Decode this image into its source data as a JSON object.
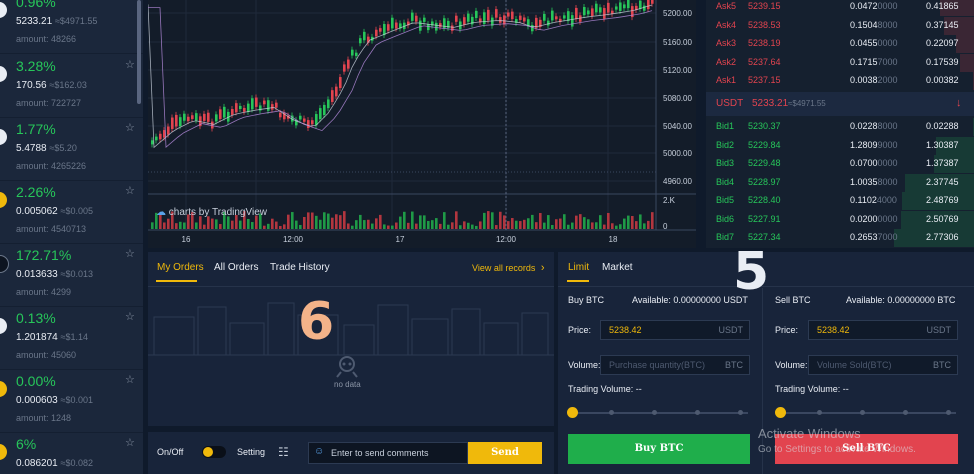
{
  "markets": [
    {
      "change": "0.96%",
      "price": "5233.21",
      "approx": "≈$4971.55",
      "amount": "amount: 48266"
    },
    {
      "change": "3.28%",
      "price": "170.56",
      "approx": "≈$162.03",
      "amount": "amount: 722727"
    },
    {
      "change": "1.77%",
      "price": "5.4788",
      "approx": "≈$5.20",
      "amount": "amount: 4265226"
    },
    {
      "change": "2.26%",
      "price": "0.005062",
      "approx": "≈$0.005",
      "amount": "amount: 4540713"
    },
    {
      "change": "172.71%",
      "price": "0.013633",
      "approx": "≈$0.013",
      "amount": "amount: 4299"
    },
    {
      "change": "0.13%",
      "price": "1.201874",
      "approx": "≈$1.14",
      "amount": "amount: 45060"
    },
    {
      "change": "0.00%",
      "price": "0.000603",
      "approx": "≈$0.001",
      "amount": "amount: 1248"
    },
    {
      "change": "6%",
      "price": "0.086201",
      "approx": "≈$0.082",
      "amount": ""
    }
  ],
  "chart": {
    "price_ticks": [
      "5200.00",
      "5160.00",
      "5120.00",
      "5080.00",
      "5040.00",
      "5000.00",
      "4960.00"
    ],
    "volume_ticks": [
      "2.K",
      "0"
    ],
    "time_ticks": [
      "16",
      "12:00",
      "17",
      "12:00",
      "18"
    ],
    "watermark": "charts by TradingView"
  },
  "orderbook": {
    "asks": [
      {
        "name": "Ask5",
        "price": "5239.15",
        "qty": "0.0472",
        "qty_tail": "0000",
        "total": "0.41865",
        "depth": 0.42
      },
      {
        "name": "Ask4",
        "price": "5238.53",
        "qty": "0.1504",
        "qty_tail": "8000",
        "total": "0.37145",
        "depth": 0.37
      },
      {
        "name": "Ask3",
        "price": "5238.19",
        "qty": "0.0455",
        "qty_tail": "0000",
        "total": "0.22097",
        "depth": 0.22
      },
      {
        "name": "Ask2",
        "price": "5237.64",
        "qty": "0.1715",
        "qty_tail": "7000",
        "total": "0.17539",
        "depth": 0.18
      },
      {
        "name": "Ask1",
        "price": "5237.15",
        "qty": "0.0038",
        "qty_tail": "2000",
        "total": "0.00382",
        "depth": 0.01
      }
    ],
    "last": {
      "symbol": "USDT",
      "price": "5233.21",
      "approx": "≈$4971.55",
      "arrow": "↓"
    },
    "bids": [
      {
        "name": "Bid1",
        "price": "5230.37",
        "qty": "0.0228",
        "qty_tail": "8000",
        "total": "0.02288",
        "depth": 0.01
      },
      {
        "name": "Bid2",
        "price": "5229.84",
        "qty": "1.2809",
        "qty_tail": "9000",
        "total": "1.30387",
        "depth": 0.47
      },
      {
        "name": "Bid3",
        "price": "5229.48",
        "qty": "0.0700",
        "qty_tail": "0000",
        "total": "1.37387",
        "depth": 0.5
      },
      {
        "name": "Bid4",
        "price": "5228.97",
        "qty": "1.0035",
        "qty_tail": "8000",
        "total": "2.37745",
        "depth": 0.86
      },
      {
        "name": "Bid5",
        "price": "5228.40",
        "qty": "0.1102",
        "qty_tail": "4000",
        "total": "2.48769",
        "depth": 0.9
      },
      {
        "name": "Bid6",
        "price": "5227.91",
        "qty": "0.0200",
        "qty_tail": "0000",
        "total": "2.50769",
        "depth": 0.91
      },
      {
        "name": "Bid7",
        "price": "5227.34",
        "qty": "0.2653",
        "qty_tail": "7000",
        "total": "2.77306",
        "depth": 1.0
      }
    ]
  },
  "orders": {
    "tabs": [
      "My Orders",
      "All Orders",
      "Trade History"
    ],
    "view_all": "View all records",
    "empty": "no data",
    "overlay_number": "6"
  },
  "chat": {
    "onoff": "On/Off",
    "setting": "Setting",
    "placeholder": "Enter to send comments",
    "send": "Send"
  },
  "trade": {
    "tabs": [
      "Limit",
      "Market"
    ],
    "overlay_number": "5",
    "buy": {
      "title": "Buy BTC",
      "available": "Available:  0.00000000 USDT",
      "price_label": "Price:",
      "price": "5238.42",
      "unit": "USDT",
      "volume_label": "Volume:",
      "volume_placeholder": "Purchase quantity(BTC)",
      "volume_unit": "BTC",
      "trading_volume": "Trading Volume:  --",
      "button": "Buy BTC"
    },
    "sell": {
      "title": "Sell BTC",
      "available": "Available:  0.00000000 BTC",
      "price_label": "Price:",
      "price": "5238.42",
      "unit": "USDT",
      "volume_label": "Volume:",
      "volume_placeholder": "Volume Sold(BTC)",
      "volume_unit": "BTC",
      "trading_volume": "Trading Volume:  --",
      "button": "Sell BTC"
    }
  },
  "activate": {
    "line1": "Activate Windows",
    "line2": "Go to Settings to activate Windows."
  },
  "colors": {
    "up": "#27c65a",
    "down": "#e2444f",
    "accent": "#f0b90b",
    "buy": "#1fae4b",
    "sell": "#e2444f"
  }
}
